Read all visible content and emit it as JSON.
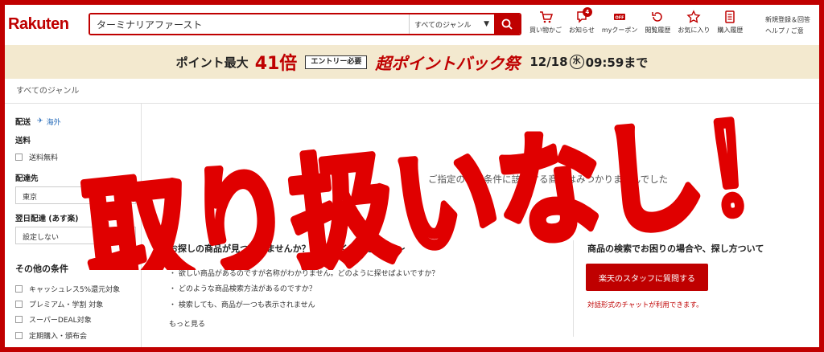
{
  "header": {
    "logo": "Rakuten",
    "search_value": "ターミナリアファースト",
    "genre": "すべてのジャンル",
    "icons": [
      {
        "label": "買い物かご",
        "icon": "cart-icon"
      },
      {
        "label": "お知らせ",
        "icon": "bell-icon",
        "badge": "4"
      },
      {
        "label": "myクーポン",
        "icon": "coupon-icon"
      },
      {
        "label": "閲覧履歴",
        "icon": "history-icon"
      },
      {
        "label": "お気に入り",
        "icon": "star-icon"
      },
      {
        "label": "購入履歴",
        "icon": "receipt-icon"
      }
    ],
    "register": "新規登録＆回答",
    "help": "ヘルプ / ご意"
  },
  "banner": {
    "text1": "ポイント最大",
    "text2": "41倍",
    "entry": "エントリー必要",
    "text3": "超ポイントバック祭",
    "date": "12/18",
    "weekday": "水",
    "time": "09:59まで"
  },
  "breadcrumb": "すべてのジャンル",
  "sidebar": {
    "delivery_heading": "配送",
    "overseas": "海外",
    "shipping_heading": "送料",
    "free_shipping": "送料無料",
    "dest_heading": "配達先",
    "dest_value": "東京",
    "nextday_heading": "翌日配達 (あす楽)",
    "nextday_value": "設定しない",
    "other_heading": "その他の条件",
    "conditions": [
      "キャッシュレス5%還元対象",
      "プレミアム・学割 対象",
      "スーパーDEAL対象",
      "定期購入・頒布会"
    ]
  },
  "main": {
    "no_result": "ご指定の検索条件に該当する商品はみつかりませんでした",
    "faq_title": "お探しの商品が見つかりませんか？　～ よくあるご質問 ～",
    "faq_items": [
      "欲しい商品があるのですが名称がわかりません。どのように探せばよいですか？",
      "どのような商品検索方法があるのですか？",
      "検索しても、商品が一つも表示されません"
    ],
    "more": "もっと見る",
    "help_title": "商品の検索でお困りの場合や、探し方ついて",
    "ask_button": "楽天のスタッフに質問する",
    "chat_note": "対話形式のチャットが利用できます。"
  },
  "overlay": {
    "text": "取り扱いなし！"
  },
  "colors": {
    "brand": "#bf0000",
    "frame": "#c00000",
    "banner_bg": "#f3e9cf"
  }
}
